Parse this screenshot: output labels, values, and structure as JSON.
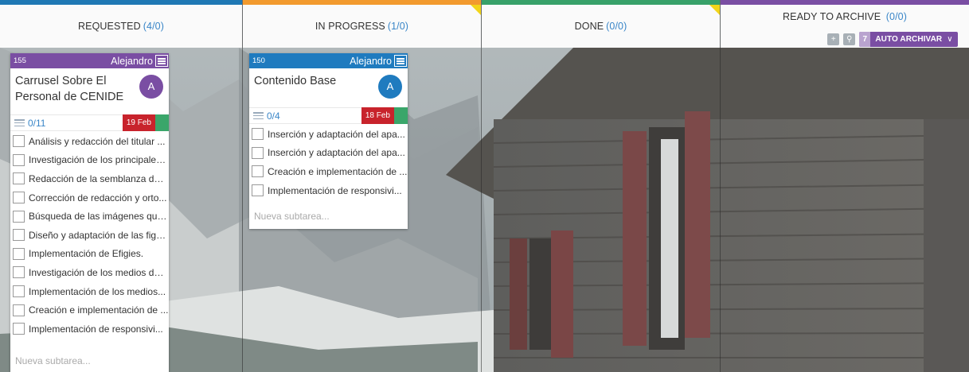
{
  "columns": [
    {
      "title": "REQUESTED",
      "count": "(4/0)"
    },
    {
      "title": "IN PROGRESS",
      "count": "(1/0)"
    },
    {
      "title": "DONE",
      "count": "(0/0)"
    },
    {
      "title": "READY TO ARCHIVE",
      "count": "(0/0)"
    }
  ],
  "archive": {
    "count": "7",
    "label": "AUTO ARCHIVAR",
    "add_icon": "plus-icon",
    "search_icon": "search-icon"
  },
  "cards": [
    {
      "id": "155",
      "owner": "Alejandro",
      "title": "Carrusel Sobre El Personal de CENIDE",
      "avatar": "A",
      "progress": "0/11",
      "due": "19 Feb",
      "color": "#7a4ea3",
      "subtasks": [
        "Análisis y redacción del titular ...",
        "Investigación de los principales...",
        "Redacción de la semblanza del ...",
        "Corrección de redacción y orto...",
        "Búsqueda de las imágenes que...",
        "Diseño y adaptación de las figu...",
        "Implementación de Efigies.",
        "Investigación de los medios de ...",
        "Implementación de los medios...",
        "Creación e implementación de ...",
        "Implementación de responsivi..."
      ],
      "new_subtask": "Nueva subtarea..."
    },
    {
      "id": "150",
      "owner": "Alejandro",
      "title": "Contenido Base",
      "avatar": "A",
      "progress": "0/4",
      "due": "18 Feb",
      "color": "#1f7bbf",
      "subtasks": [
        "Inserción y adaptación del apa...",
        "Inserción y adaptación del apa...",
        "Creación e implementación de ...",
        "Implementación de responsivi..."
      ],
      "new_subtask": "Nueva subtarea..."
    }
  ],
  "colors": {
    "requested": "#1f78b4",
    "in_progress": "#f29a2e",
    "done": "#38a169",
    "archive": "#7a4ea3",
    "due_badge": "#c8232c",
    "count_text": "#3a86c8"
  }
}
